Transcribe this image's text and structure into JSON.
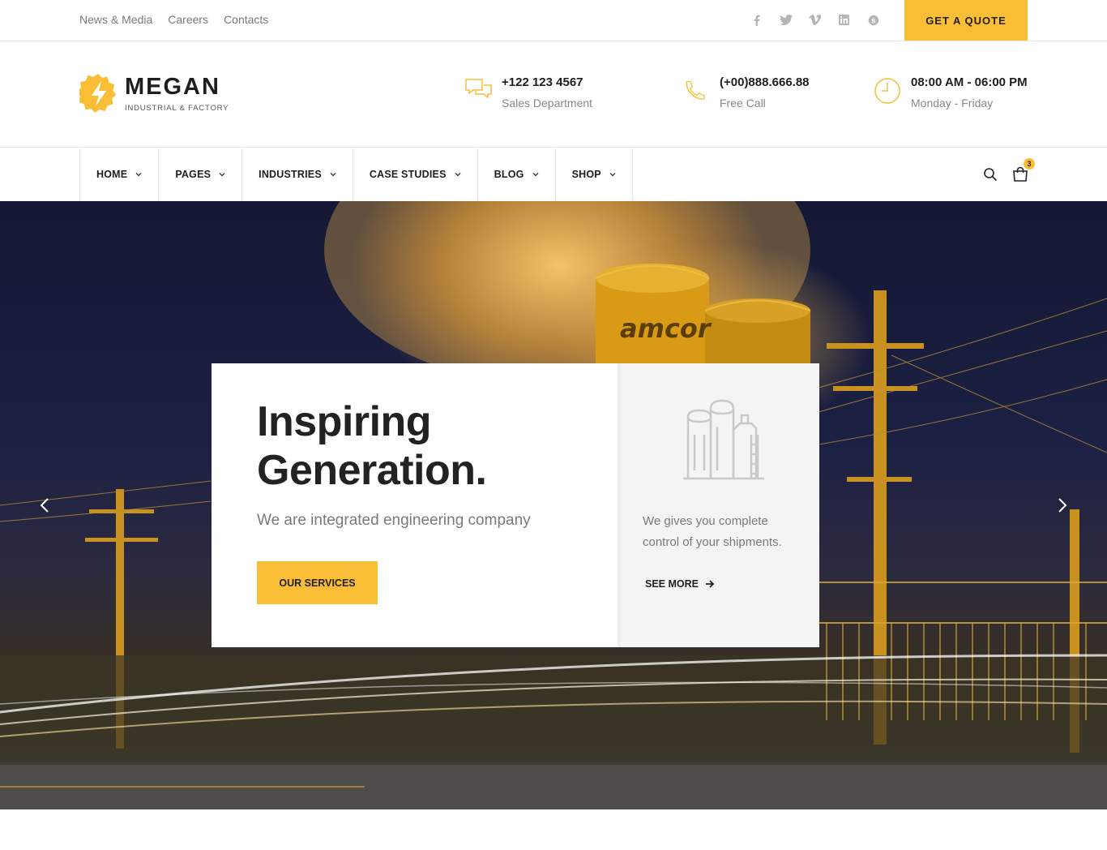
{
  "topbar": {
    "links": [
      "News & Media",
      "Careers",
      "Contacts"
    ],
    "socials": [
      "facebook-icon",
      "twitter-icon",
      "vimeo-icon",
      "linkedin-icon",
      "skype-icon"
    ],
    "quote_label": "GET A QUOTE"
  },
  "brand": {
    "name": "MEGAN",
    "tagline": "INDUSTRIAL & FACTORY"
  },
  "contacts": [
    {
      "icon": "chat-icon",
      "main": "+122 123 4567",
      "sub": "Sales Department"
    },
    {
      "icon": "phone-icon",
      "main": "(+00)888.666.88",
      "sub": "Free Call"
    },
    {
      "icon": "clock-icon",
      "main": "08:00 AM - 06:00 PM",
      "sub": "Monday - Friday"
    }
  ],
  "nav": {
    "items": [
      "HOME",
      "PAGES",
      "INDUSTRIES",
      "CASE STUDIES",
      "BLOG",
      "SHOP"
    ],
    "cart_count": "3"
  },
  "hero": {
    "headline_line1": "Inspiring",
    "headline_line2": "Generation.",
    "subhead": "We are integrated engineering company",
    "services_label": "OUR SERVICES",
    "right_text": "We gives you complete control of your shipments.",
    "see_more_label": "SEE MORE",
    "tank_text": "amcor"
  },
  "colors": {
    "accent": "#f9bd36",
    "text_dark": "#222222",
    "text_muted": "#7a7a7a"
  }
}
